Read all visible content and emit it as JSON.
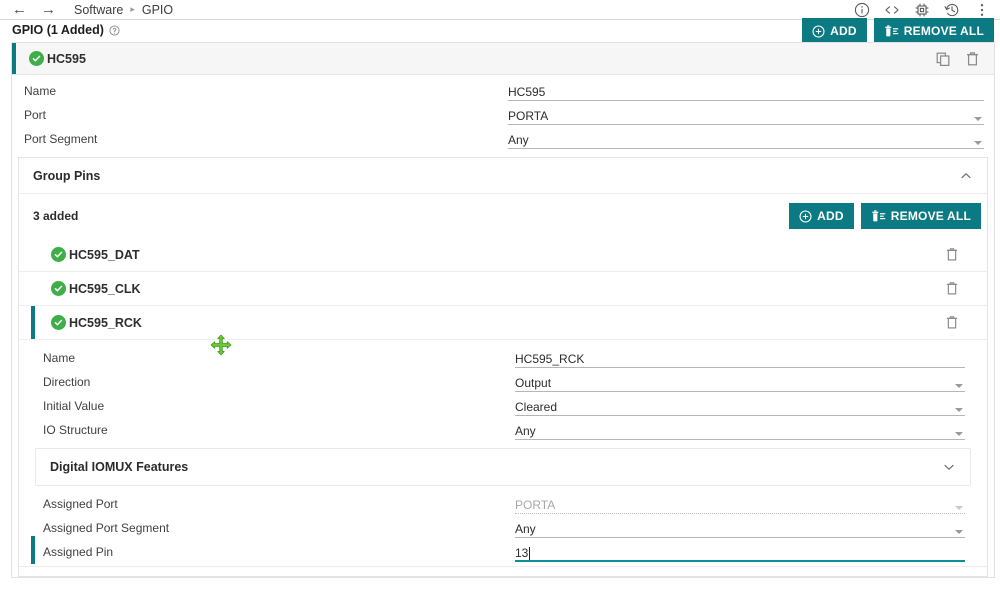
{
  "topbar": {
    "back_label": "←",
    "forward_label": "→",
    "breadcrumb": [
      "Software",
      "GPIO"
    ],
    "separator": "▸",
    "icons": [
      "info-icon",
      "code-icon",
      "chip-icon",
      "history-icon",
      "kebab-menu-icon"
    ]
  },
  "page": {
    "title": "GPIO (1 Added)",
    "help_icon": "help-circle-icon",
    "add_label": "ADD",
    "remove_all_label": "REMOVE ALL"
  },
  "item": {
    "name": "HC595",
    "status_icon": "check-circle-icon",
    "copy_icon": "duplicate-icon",
    "delete_icon": "trash-icon",
    "fields": [
      {
        "label": "Name",
        "value": "HC595",
        "type": "text"
      },
      {
        "label": "Port",
        "value": "PORTA",
        "type": "select"
      },
      {
        "label": "Port Segment",
        "value": "Any",
        "type": "select"
      }
    ]
  },
  "group_pins": {
    "title": "Group Pins",
    "collapse_icon": "chevron-up-icon",
    "count_label": "3 added",
    "add_label": "ADD",
    "remove_all_label": "REMOVE ALL",
    "pins": [
      {
        "name": "HC595_DAT",
        "selected": false
      },
      {
        "name": "HC595_CLK",
        "selected": false
      },
      {
        "name": "HC595_RCK",
        "selected": true
      }
    ]
  },
  "pin_detail": {
    "fields": [
      {
        "label": "Name",
        "value": "HC595_RCK",
        "type": "text"
      },
      {
        "label": "Direction",
        "value": "Output",
        "type": "select"
      },
      {
        "label": "Initial Value",
        "value": "Cleared",
        "type": "select"
      },
      {
        "label": "IO Structure",
        "value": "Any",
        "type": "select"
      }
    ]
  },
  "iomux": {
    "title": "Digital IOMUX Features",
    "expand_icon": "chevron-down-icon"
  },
  "assigned": {
    "fields": [
      {
        "label": "Assigned Port",
        "value": "PORTA",
        "type": "select",
        "disabled": true
      },
      {
        "label": "Assigned Port Segment",
        "value": "Any",
        "type": "select",
        "disabled": false
      },
      {
        "label": "Assigned Pin",
        "value": "13",
        "type": "text",
        "focused": true
      }
    ]
  },
  "cursor": {
    "icon": "move-cursor-icon"
  },
  "colors": {
    "accent": "#0b7a83",
    "focus_underline": "#0b8f99",
    "status_green": "#3fae49",
    "cursor_green": "#62c93f"
  }
}
